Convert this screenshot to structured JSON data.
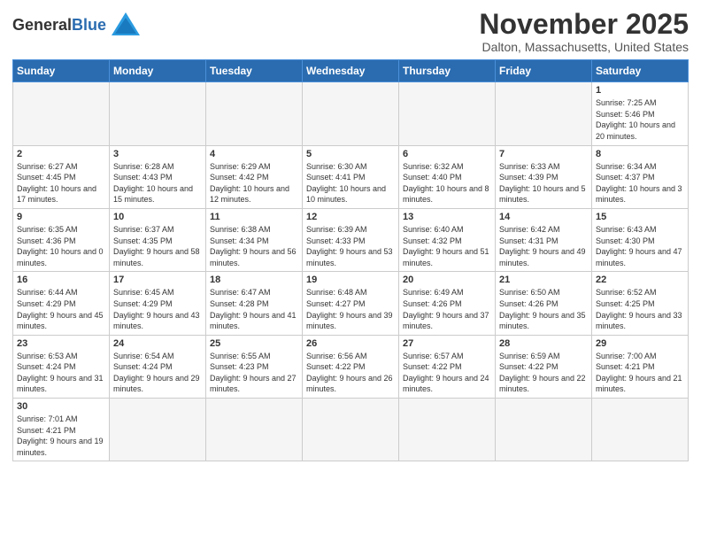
{
  "header": {
    "logo_general": "General",
    "logo_blue": "Blue",
    "title": "November 2025",
    "subtitle": "Dalton, Massachusetts, United States"
  },
  "weekdays": [
    "Sunday",
    "Monday",
    "Tuesday",
    "Wednesday",
    "Thursday",
    "Friday",
    "Saturday"
  ],
  "weeks": [
    [
      {
        "day": "",
        "info": ""
      },
      {
        "day": "",
        "info": ""
      },
      {
        "day": "",
        "info": ""
      },
      {
        "day": "",
        "info": ""
      },
      {
        "day": "",
        "info": ""
      },
      {
        "day": "",
        "info": ""
      },
      {
        "day": "1",
        "info": "Sunrise: 7:25 AM\nSunset: 5:46 PM\nDaylight: 10 hours\nand 20 minutes."
      }
    ],
    [
      {
        "day": "2",
        "info": "Sunrise: 6:27 AM\nSunset: 4:45 PM\nDaylight: 10 hours\nand 17 minutes."
      },
      {
        "day": "3",
        "info": "Sunrise: 6:28 AM\nSunset: 4:43 PM\nDaylight: 10 hours\nand 15 minutes."
      },
      {
        "day": "4",
        "info": "Sunrise: 6:29 AM\nSunset: 4:42 PM\nDaylight: 10 hours\nand 12 minutes."
      },
      {
        "day": "5",
        "info": "Sunrise: 6:30 AM\nSunset: 4:41 PM\nDaylight: 10 hours\nand 10 minutes."
      },
      {
        "day": "6",
        "info": "Sunrise: 6:32 AM\nSunset: 4:40 PM\nDaylight: 10 hours\nand 8 minutes."
      },
      {
        "day": "7",
        "info": "Sunrise: 6:33 AM\nSunset: 4:39 PM\nDaylight: 10 hours\nand 5 minutes."
      },
      {
        "day": "8",
        "info": "Sunrise: 6:34 AM\nSunset: 4:37 PM\nDaylight: 10 hours\nand 3 minutes."
      }
    ],
    [
      {
        "day": "9",
        "info": "Sunrise: 6:35 AM\nSunset: 4:36 PM\nDaylight: 10 hours\nand 0 minutes."
      },
      {
        "day": "10",
        "info": "Sunrise: 6:37 AM\nSunset: 4:35 PM\nDaylight: 9 hours\nand 58 minutes."
      },
      {
        "day": "11",
        "info": "Sunrise: 6:38 AM\nSunset: 4:34 PM\nDaylight: 9 hours\nand 56 minutes."
      },
      {
        "day": "12",
        "info": "Sunrise: 6:39 AM\nSunset: 4:33 PM\nDaylight: 9 hours\nand 53 minutes."
      },
      {
        "day": "13",
        "info": "Sunrise: 6:40 AM\nSunset: 4:32 PM\nDaylight: 9 hours\nand 51 minutes."
      },
      {
        "day": "14",
        "info": "Sunrise: 6:42 AM\nSunset: 4:31 PM\nDaylight: 9 hours\nand 49 minutes."
      },
      {
        "day": "15",
        "info": "Sunrise: 6:43 AM\nSunset: 4:30 PM\nDaylight: 9 hours\nand 47 minutes."
      }
    ],
    [
      {
        "day": "16",
        "info": "Sunrise: 6:44 AM\nSunset: 4:29 PM\nDaylight: 9 hours\nand 45 minutes."
      },
      {
        "day": "17",
        "info": "Sunrise: 6:45 AM\nSunset: 4:29 PM\nDaylight: 9 hours\nand 43 minutes."
      },
      {
        "day": "18",
        "info": "Sunrise: 6:47 AM\nSunset: 4:28 PM\nDaylight: 9 hours\nand 41 minutes."
      },
      {
        "day": "19",
        "info": "Sunrise: 6:48 AM\nSunset: 4:27 PM\nDaylight: 9 hours\nand 39 minutes."
      },
      {
        "day": "20",
        "info": "Sunrise: 6:49 AM\nSunset: 4:26 PM\nDaylight: 9 hours\nand 37 minutes."
      },
      {
        "day": "21",
        "info": "Sunrise: 6:50 AM\nSunset: 4:26 PM\nDaylight: 9 hours\nand 35 minutes."
      },
      {
        "day": "22",
        "info": "Sunrise: 6:52 AM\nSunset: 4:25 PM\nDaylight: 9 hours\nand 33 minutes."
      }
    ],
    [
      {
        "day": "23",
        "info": "Sunrise: 6:53 AM\nSunset: 4:24 PM\nDaylight: 9 hours\nand 31 minutes."
      },
      {
        "day": "24",
        "info": "Sunrise: 6:54 AM\nSunset: 4:24 PM\nDaylight: 9 hours\nand 29 minutes."
      },
      {
        "day": "25",
        "info": "Sunrise: 6:55 AM\nSunset: 4:23 PM\nDaylight: 9 hours\nand 27 minutes."
      },
      {
        "day": "26",
        "info": "Sunrise: 6:56 AM\nSunset: 4:22 PM\nDaylight: 9 hours\nand 26 minutes."
      },
      {
        "day": "27",
        "info": "Sunrise: 6:57 AM\nSunset: 4:22 PM\nDaylight: 9 hours\nand 24 minutes."
      },
      {
        "day": "28",
        "info": "Sunrise: 6:59 AM\nSunset: 4:22 PM\nDaylight: 9 hours\nand 22 minutes."
      },
      {
        "day": "29",
        "info": "Sunrise: 7:00 AM\nSunset: 4:21 PM\nDaylight: 9 hours\nand 21 minutes."
      }
    ],
    [
      {
        "day": "30",
        "info": "Sunrise: 7:01 AM\nSunset: 4:21 PM\nDaylight: 9 hours\nand 19 minutes."
      },
      {
        "day": "",
        "info": ""
      },
      {
        "day": "",
        "info": ""
      },
      {
        "day": "",
        "info": ""
      },
      {
        "day": "",
        "info": ""
      },
      {
        "day": "",
        "info": ""
      },
      {
        "day": "",
        "info": ""
      }
    ]
  ]
}
